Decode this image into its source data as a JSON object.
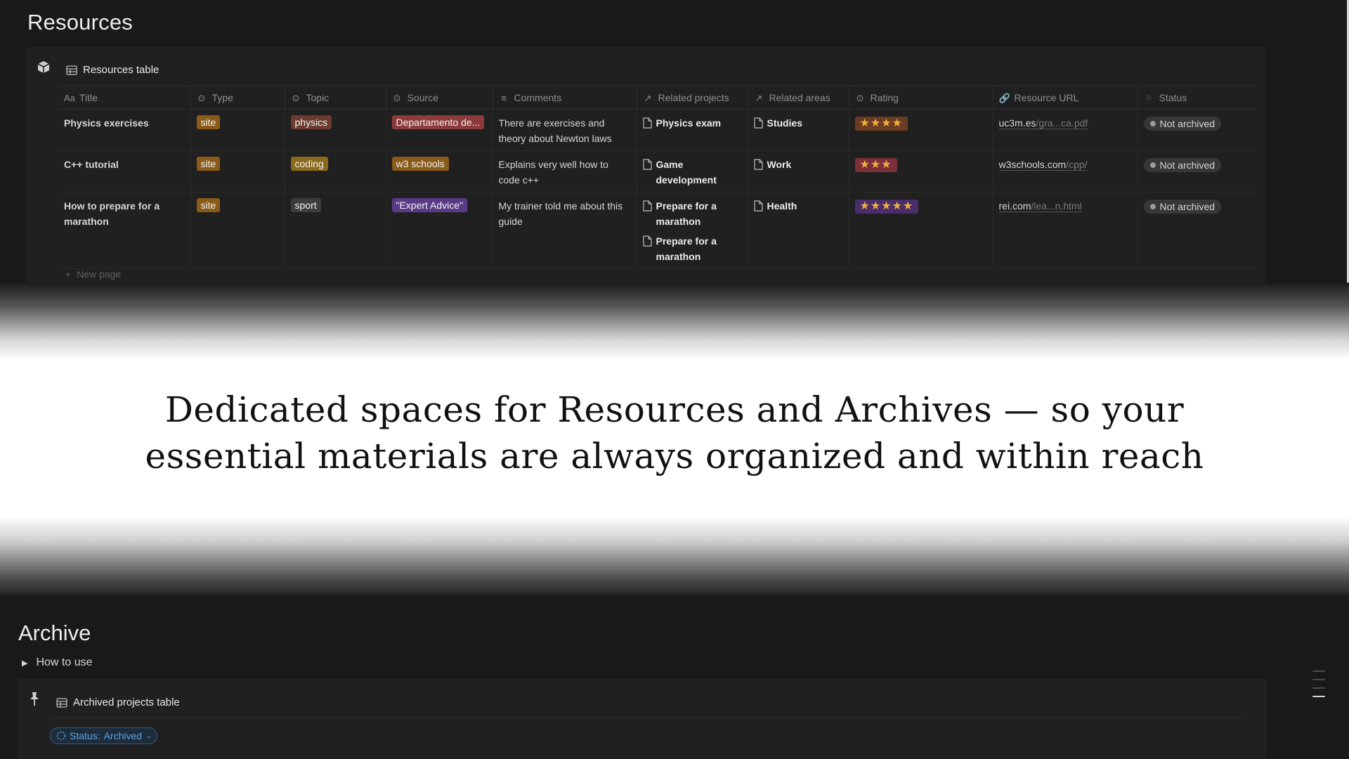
{
  "resources": {
    "page_title": "Resources",
    "table_title": "Resources table",
    "columns": [
      {
        "icon": "title-aa-icon",
        "label": "Title",
        "glyph": "Aa"
      },
      {
        "icon": "select-icon",
        "label": "Type",
        "glyph": "⊙"
      },
      {
        "icon": "select-icon",
        "label": "Topic",
        "glyph": "⊙"
      },
      {
        "icon": "select-icon",
        "label": "Source",
        "glyph": "⊙"
      },
      {
        "icon": "text-lines-icon",
        "label": "Comments",
        "glyph": "≡"
      },
      {
        "icon": "relation-arrow-icon",
        "label": "Related projects",
        "glyph": "↗"
      },
      {
        "icon": "relation-arrow-icon",
        "label": "Related areas",
        "glyph": "↗"
      },
      {
        "icon": "select-icon",
        "label": "Rating",
        "glyph": "⊙"
      },
      {
        "icon": "link-icon",
        "label": "Resource URL",
        "glyph": "🔗"
      },
      {
        "icon": "status-icon",
        "label": "Status",
        "glyph": "⁘"
      }
    ],
    "rows": [
      {
        "title": "Physics exercises",
        "type": "site",
        "type_color": "#8a5a19",
        "topic": "physics",
        "topic_color": "#6b3b2e",
        "source": "Departamento de...",
        "source_color": "#8c3a3a",
        "comments": "There are exercises and theory about Newton laws",
        "related_projects": [
          "Physics exam"
        ],
        "related_areas": "Studies",
        "rating": "★★★★",
        "rating_color": "#6b3b23",
        "url_host": "uc3m.es",
        "url_path": "/gra...ca.pdf",
        "status": "Not archived"
      },
      {
        "title": "C++ tutorial",
        "type": "site",
        "type_color": "#8a5a19",
        "topic": "coding",
        "topic_color": "#8a6a1c",
        "source": "w3 schools",
        "source_color": "#8a5a19",
        "comments": "Explains very well how to code c++",
        "related_projects": [
          "Game development"
        ],
        "related_areas": "Work",
        "rating": "★★★",
        "rating_color": "#7a2f3a",
        "url_host": "w3schools.com",
        "url_path": "/cpp/",
        "status": "Not archived"
      },
      {
        "title": "How to prepare for a marathon",
        "type": "site",
        "type_color": "#8a5a19",
        "topic": "sport",
        "topic_color": "#3d3d3d",
        "source": "\"Expert Advice\"",
        "source_color": "#5a3a87",
        "comments": "My trainer told me about this guide",
        "related_projects": [
          "Prepare for a marathon",
          "Prepare for a marathon"
        ],
        "related_areas": "Health",
        "rating": "★★★★★",
        "rating_color": "#4a2d6b",
        "url_host": "rei.com",
        "url_path": "/lea...n.html",
        "status": "Not archived"
      }
    ],
    "new_page_label": "New page"
  },
  "headline": {
    "line1": "Dedicated spaces for Resources and Archives — so your",
    "line2": "essential materials are always organized and within reach"
  },
  "archive": {
    "page_title": "Archive",
    "toggle_label": "How to use",
    "table_title": "Archived projects table",
    "filter_prefix": "Status:",
    "filter_value": "Archived"
  }
}
